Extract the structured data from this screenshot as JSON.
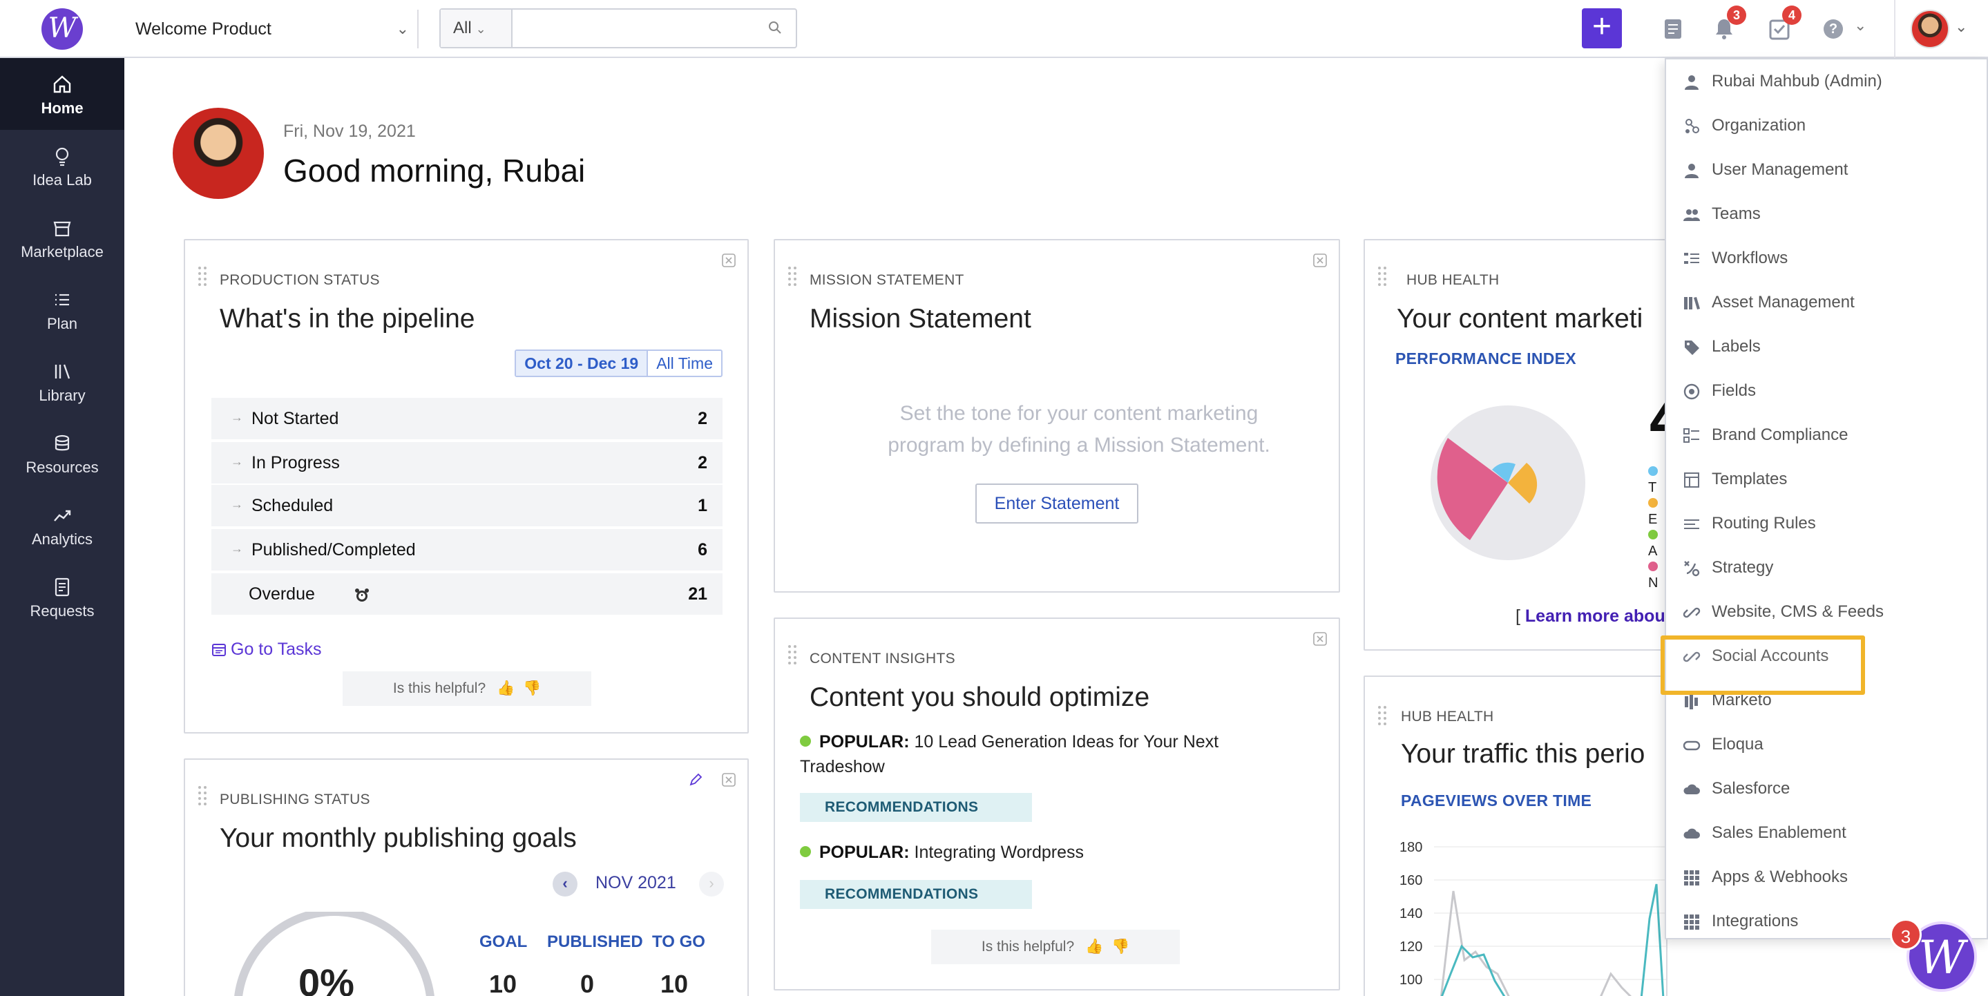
{
  "topbar": {
    "product": "Welcome Product",
    "search_scope": "All",
    "search_placeholder": "",
    "notifications_count": "3",
    "tasks_count": "4",
    "help": "?"
  },
  "sidebar": {
    "items": [
      {
        "label": "Home",
        "icon": "home-icon"
      },
      {
        "label": "Idea Lab",
        "icon": "lightbulb-icon"
      },
      {
        "label": "Marketplace",
        "icon": "store-icon"
      },
      {
        "label": "Plan",
        "icon": "list-icon"
      },
      {
        "label": "Library",
        "icon": "library-icon"
      },
      {
        "label": "Resources",
        "icon": "database-icon"
      },
      {
        "label": "Analytics",
        "icon": "trend-icon"
      },
      {
        "label": "Requests",
        "icon": "document-icon"
      }
    ]
  },
  "greeting": {
    "date": "Fri, Nov 19, 2021",
    "title": "Good morning, Rubai"
  },
  "production": {
    "kicker": "PRODUCTION STATUS",
    "title": "What's in the pipeline",
    "range_selected": "Oct 20 - Dec 19",
    "range_all": "All Time",
    "rows": [
      {
        "label": "Not Started",
        "count": "2"
      },
      {
        "label": "In Progress",
        "count": "2"
      },
      {
        "label": "Scheduled",
        "count": "1"
      },
      {
        "label": "Published/Completed",
        "count": "6"
      },
      {
        "label": "Overdue",
        "count": "21"
      }
    ],
    "goto": "Go to Tasks",
    "helpful": "Is this helpful?"
  },
  "publishing": {
    "kicker": "PUBLISHING STATUS",
    "title": "Your monthly publishing goals",
    "month": "NOV 2021",
    "percent": "0%",
    "goal_label": "GOAL",
    "published_label": "PUBLISHED",
    "togo_label": "TO GO",
    "goal_value": "10",
    "published_value": "0",
    "togo_value": "10"
  },
  "mission": {
    "kicker": "MISSION STATEMENT",
    "title": "Mission Statement",
    "placeholder_line1": "Set the tone for your content marketing",
    "placeholder_line2": "program by defining a Mission Statement.",
    "button": "Enter Statement"
  },
  "insights": {
    "kicker": "CONTENT INSIGHTS",
    "title": "Content you should optimize",
    "items": [
      {
        "tag": "POPULAR:",
        "line1": "10 Lead Generation Ideas for Your Next",
        "line2": "Tradeshow",
        "badge": "RECOMMENDATIONS"
      },
      {
        "tag": "POPULAR:",
        "line1": "Integrating Wordpress",
        "line2": "",
        "badge": "RECOMMENDATIONS"
      }
    ],
    "helpful": "Is this helpful?"
  },
  "hub1": {
    "kicker": "HUB HEALTH",
    "title": "Your content marketi",
    "label": "PERFORMANCE INDEX",
    "big_number": "4",
    "legend_letters": [
      "T",
      "E",
      "A",
      "N"
    ],
    "learn_bracket": "[",
    "learn": "Learn more abou",
    "legend_colors": [
      "#6ec6f0",
      "#f3b33d",
      "#7fcb3f",
      "#e0608c"
    ]
  },
  "hub2": {
    "kicker": "HUB HEALTH",
    "title": "Your traffic this perio",
    "label": "PAGEVIEWS OVER TIME",
    "y_ticks": [
      "180",
      "160",
      "140",
      "120",
      "100"
    ]
  },
  "menu": {
    "items": [
      {
        "label": "Rubai Mahbub (Admin)",
        "icon": "user-icon"
      },
      {
        "label": "Organization",
        "icon": "organization-icon"
      },
      {
        "label": "User Management",
        "icon": "user-management-icon"
      },
      {
        "label": "Teams",
        "icon": "teams-icon"
      },
      {
        "label": "Workflows",
        "icon": "workflow-icon"
      },
      {
        "label": "Asset Management",
        "icon": "books-icon"
      },
      {
        "label": "Labels",
        "icon": "tag-icon"
      },
      {
        "label": "Fields",
        "icon": "target-icon"
      },
      {
        "label": "Brand Compliance",
        "icon": "checklist-icon"
      },
      {
        "label": "Templates",
        "icon": "template-icon"
      },
      {
        "label": "Routing Rules",
        "icon": "routing-icon"
      },
      {
        "label": "Strategy",
        "icon": "strategy-icon"
      },
      {
        "label": "Website, CMS & Feeds",
        "icon": "link-icon"
      },
      {
        "label": "Social Accounts",
        "icon": "link-icon"
      },
      {
        "label": "Marketo",
        "icon": "marketo-icon"
      },
      {
        "label": "Eloqua",
        "icon": "eloqua-icon"
      },
      {
        "label": "Salesforce",
        "icon": "cloud-icon"
      },
      {
        "label": "Sales Enablement",
        "icon": "cloud-icon"
      },
      {
        "label": "Apps & Webhooks",
        "icon": "grid-icon"
      },
      {
        "label": "Integrations",
        "icon": "grid-icon"
      }
    ]
  },
  "chat": {
    "badge": "3",
    "letter": "W"
  },
  "colors": {
    "accent": "#5b36d6",
    "sidebar": "#262a3d",
    "highlight": "#f1b52a"
  }
}
